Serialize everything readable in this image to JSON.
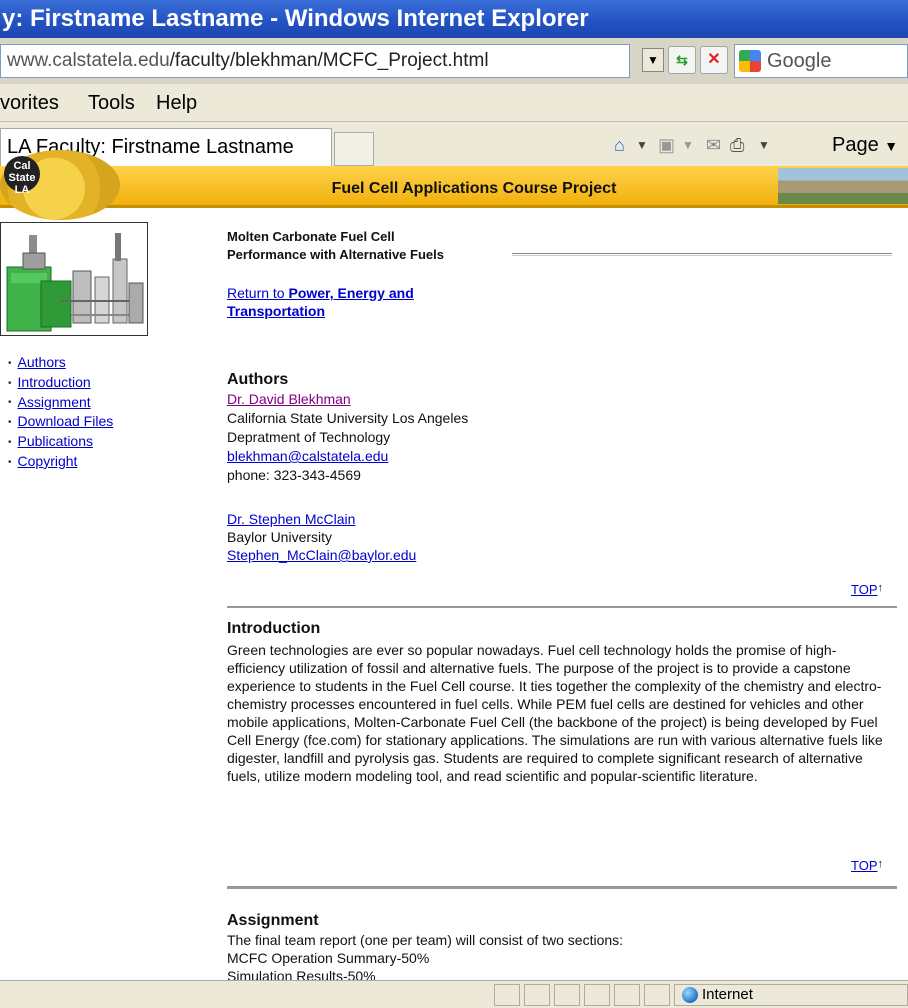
{
  "window": {
    "title": "y: Firstname Lastname - Windows Internet Explorer"
  },
  "address_bar": {
    "url_grey_prefix": "www.calstatela.edu",
    "url_rest": "/faculty/blekhman/MCFC_Project.html",
    "search_placeholder": "Google"
  },
  "menu": {
    "items": [
      "vorites",
      "Tools",
      "Help"
    ]
  },
  "tabs": {
    "active_tab_label": "LA Faculty: Firstname Lastname",
    "page_menu_label": "Page"
  },
  "banner": {
    "title": "Fuel Cell Applications Course Project",
    "seal_text": "Cal State LA"
  },
  "sidebar": {
    "nav": [
      "Authors",
      "Introduction",
      "Assignment",
      "Download Files",
      "Publications",
      "Copyright"
    ]
  },
  "main": {
    "project_title_line1": "Molten Carbonate Fuel Cell",
    "project_title_line2": "Performance with Alternative Fuels",
    "return_link_prefix": "Return to ",
    "return_link_bold1": "Power, Energy and",
    "return_link_bold2": "Transportation",
    "top_link": "TOP",
    "authors": {
      "heading": "Authors",
      "author1_name": "Dr. David Blekhman",
      "author1_affiliation": "California State University Los Angeles",
      "author1_department": "Depratment of Technology",
      "author1_email": "blekhman@calstatela.edu",
      "author1_phone": "phone: 323-343-4569",
      "author2_name": "Dr. Stephen McClain",
      "author2_affiliation": "Baylor University",
      "author2_email": "Stephen_McClain@baylor.edu"
    },
    "introduction": {
      "heading": "Introduction",
      "text": "Green technologies are ever so popular nowadays. Fuel cell technology holds the promise of high-efficiency utilization of fossil and alternative fuels. The purpose of the project is to provide a capstone experience to students in the Fuel Cell course. It ties together the complexity of the chemistry and electro-chemistry processes encountered in fuel cells. While PEM fuel cells are destined for vehicles and other mobile applications, Molten-Carbonate Fuel Cell (the backbone of the project) is being developed by Fuel Cell Energy (fce.com) for stationary applications. The simulations are run with various alternative fuels like digester, landfill and pyrolysis gas. Students are required to complete significant research of alternative fuels, utilize modern modeling tool, and read scientific and popular-scientific literature."
    },
    "assignment": {
      "heading": "Assignment",
      "line1": "The final team report (one per team) will consist of two sections:",
      "line2": "MCFC Operation Summary-50%",
      "line3_partial": "Simulation Results-50%"
    }
  },
  "status_bar": {
    "zone": "Internet"
  },
  "colors": {
    "title_bar": "#2453c4",
    "banner_gold": "#f1b10c",
    "link": "#0000cc",
    "visited_link": "#800080"
  }
}
